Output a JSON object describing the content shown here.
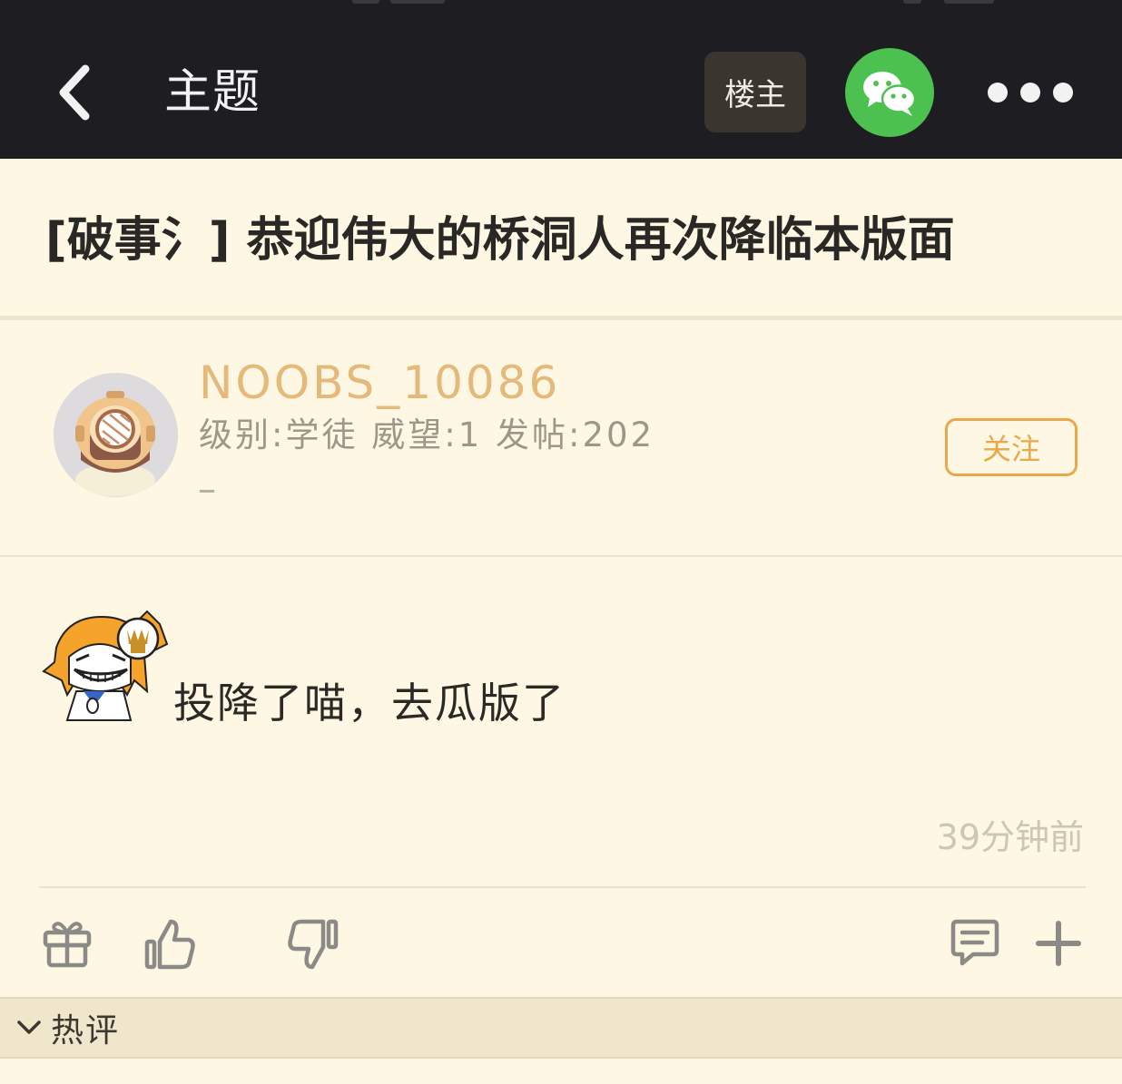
{
  "header": {
    "title": "主题",
    "poster_only_label": "楼主"
  },
  "thread": {
    "title": "[破事氵] 恭迎伟大的桥洞人再次降临本版面"
  },
  "post": {
    "author": {
      "name": "NOOBS_10086",
      "meta": "级别:学徒 威望:1 发帖:202"
    },
    "follow_label": "关注",
    "content": "投降了喵，去瓜版了",
    "time": "39分钟前"
  },
  "hot_comments": {
    "label": "热评"
  },
  "colors": {
    "topbar": "#1e1e22",
    "background": "#fdf7e3",
    "accent": "#e8a94a",
    "wechat": "#4cc14f"
  },
  "icons": {
    "back": "chevron-left-icon",
    "share": "wechat-icon",
    "more": "more-icon",
    "gift": "gift-icon",
    "like": "thumbs-up-icon",
    "dislike": "thumbs-down-icon",
    "comment": "comment-icon",
    "add": "plus-icon",
    "expand": "chevron-down-icon"
  }
}
